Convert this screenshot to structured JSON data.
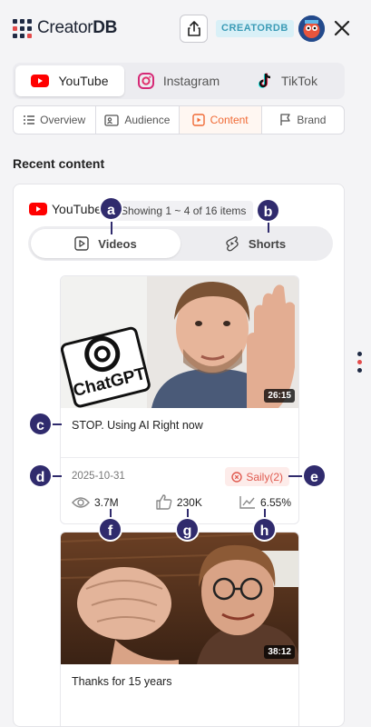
{
  "header": {
    "logo_regular": "Creator",
    "logo_bold": "DB",
    "badge": "CREATORDB",
    "share_icon": "share-icon",
    "close_icon": "close-icon"
  },
  "platform_tabs": [
    {
      "label": "YouTube",
      "icon": "youtube-icon",
      "active": true
    },
    {
      "label": "Instagram",
      "icon": "instagram-icon",
      "active": false
    },
    {
      "label": "TikTok",
      "icon": "tiktok-icon",
      "active": false
    }
  ],
  "section_tabs": [
    {
      "label": "Overview",
      "icon": "list-icon",
      "active": false
    },
    {
      "label": "Audience",
      "icon": "audience-icon",
      "active": false
    },
    {
      "label": "Content",
      "icon": "play-square-icon",
      "active": true
    },
    {
      "label": "Brand",
      "icon": "flag-icon",
      "active": false
    }
  ],
  "recent": {
    "title": "Recent content",
    "platform_label": "YouTube",
    "showing": "Showing 1 ~ 4 of 16 items",
    "toggle": {
      "videos": "Videos",
      "shorts": "Shorts",
      "active": "videos"
    }
  },
  "videos": [
    {
      "title": "STOP. Using AI Right now",
      "duration": "26:15",
      "date": "2025-10-31",
      "sponsor": "Saily(2)",
      "views": "3.7M",
      "likes": "230K",
      "engagement": "6.55%",
      "thumb_text": "ChatGPT"
    },
    {
      "title": "Thanks for 15 years",
      "duration": "38:12"
    }
  ],
  "callouts": {
    "a": "a",
    "b": "b",
    "c": "c",
    "d": "d",
    "e": "e",
    "f": "f",
    "g": "g",
    "h": "h"
  },
  "colors": {
    "accent": "#f06a35",
    "youtube_red": "#ff0000",
    "callout": "#302b6d",
    "sponsor_bg": "#fdecea",
    "sponsor_text": "#e05a4f",
    "badge_bg": "#d9f0f7"
  }
}
